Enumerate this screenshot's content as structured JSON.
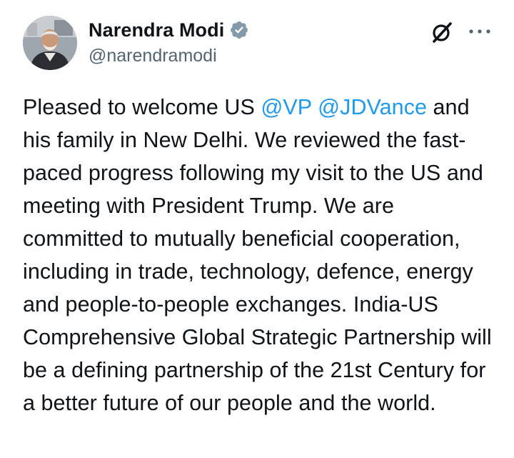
{
  "author": {
    "display_name": "Narendra Modi",
    "handle": "@narendramodi",
    "verified_badge_color": "#829aab",
    "avatar_icon": "profile-photo"
  },
  "header_actions": {
    "grok_icon": "grok-icon",
    "more_icon": "more-options-icon"
  },
  "tweet": {
    "text_part1": "Pleased to welcome US ",
    "mention1": "@VP",
    "text_space": " ",
    "mention2": "@JDVance",
    "text_part2": " and his family in New Delhi. We reviewed the fast-paced progress following my visit to the US and meeting with President Trump. We are committed to mutually beneficial cooperation, including in trade, technology, defence, energy and people-to-people exchanges. India-US Comprehensive Global Strategic Partnership will be a defining partnership of the 21st Century for a better future of our people and the world."
  },
  "colors": {
    "text": "#0f1419",
    "secondary": "#536471",
    "link": "#1d9bf0"
  }
}
